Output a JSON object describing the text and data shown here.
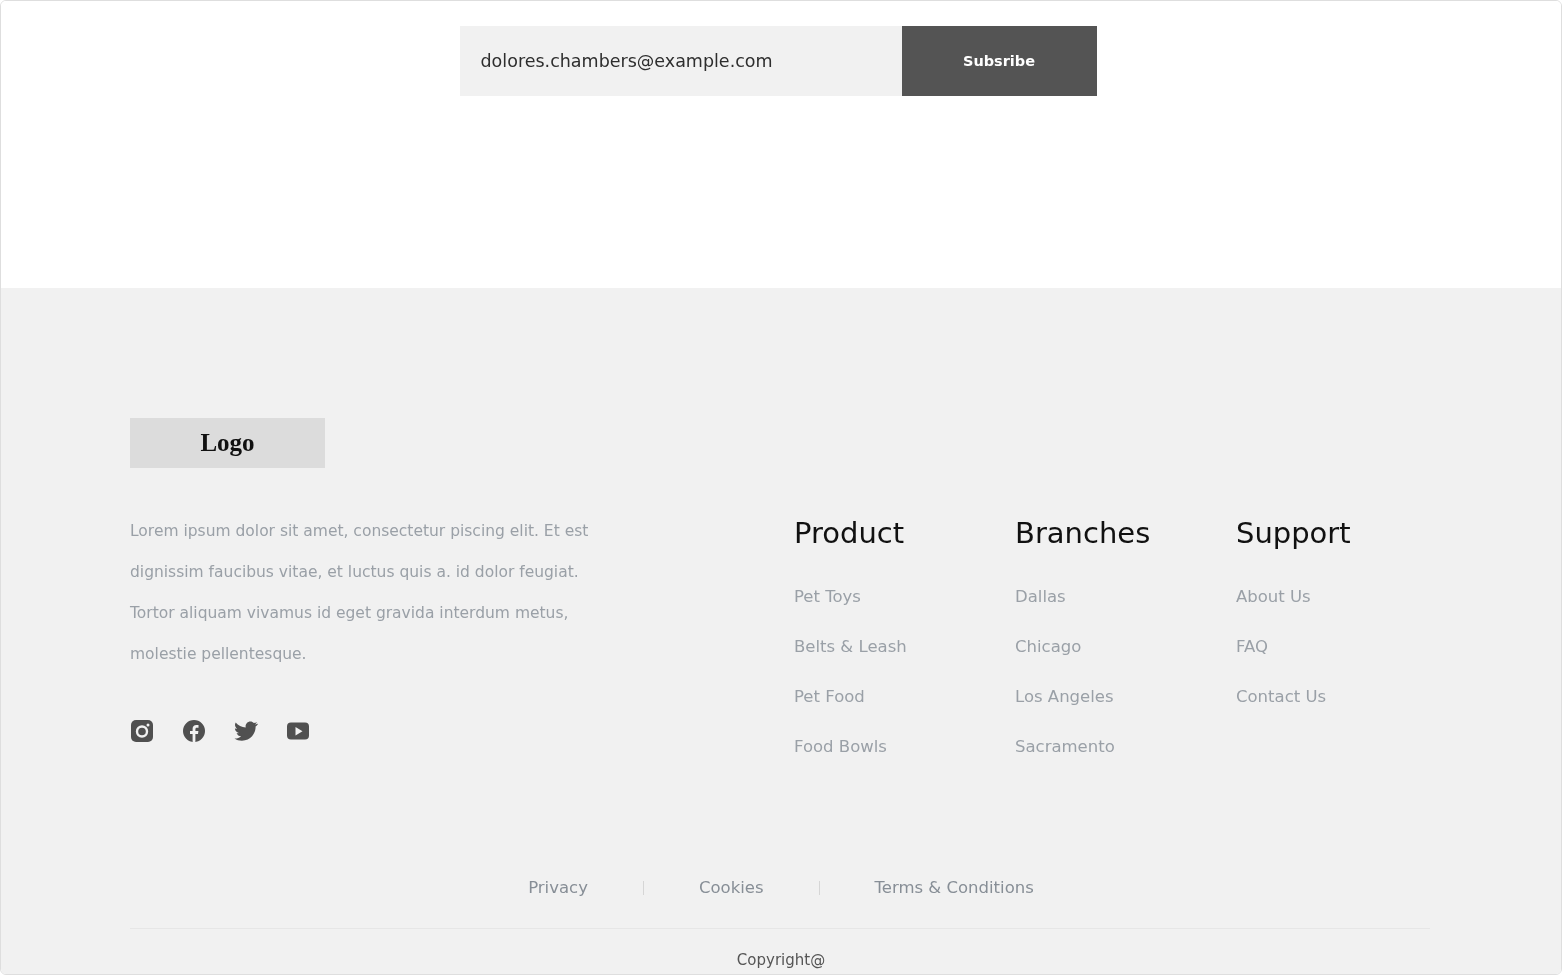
{
  "newsletter": {
    "email_field": {
      "value": "dolores.chambers@example.com"
    },
    "button": "Subsribe"
  },
  "footer": {
    "logo": "Logo",
    "description": "Lorem ipsum dolor sit amet, consectetur piscing elit. Et est dignissim faucibus vitae, et luctus quis a. id dolor feugiat. Tortor aliquam vivamus id eget gravida interdum metus, molestie pellentesque.",
    "columns": [
      {
        "title": "Product",
        "links": [
          "Pet Toys",
          "Belts & Leash",
          "Pet Food",
          "Food Bowls"
        ]
      },
      {
        "title": "Branches",
        "links": [
          "Dallas",
          "Chicago",
          "Los Angeles",
          "Sacramento"
        ]
      },
      {
        "title": "Support",
        "links": [
          "About Us",
          "FAQ",
          "Contact Us"
        ]
      }
    ],
    "legal_links": [
      "Privacy",
      "Cookies",
      "Terms & Conditions"
    ],
    "copyright": "Copyright@"
  }
}
